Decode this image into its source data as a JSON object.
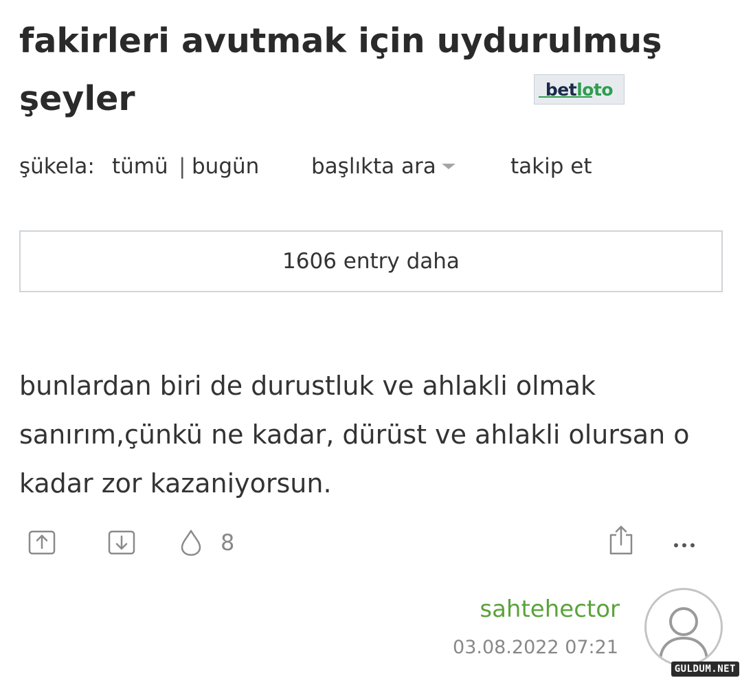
{
  "topic": {
    "title": "fakirleri avutmak için uydurulmuş şeyler"
  },
  "ad": {
    "brand_part1": "bet",
    "brand_part2": "loto"
  },
  "toolbar": {
    "sukela_label": "şükela:",
    "all_label": "tümü",
    "separator": "|",
    "today_label": "bugün",
    "search_label": "başlıkta ara",
    "follow_label": "takip et"
  },
  "more_entries": {
    "label": "1606 entry daha"
  },
  "entry": {
    "text": "bunlardan biri de durustluk ve ahlakli olmak sanırım,çünkü ne kadar, dürüst ve ahlakli olursan o kadar zor kazaniyorsun.",
    "favorite_count": "8",
    "author": "sahtehector",
    "timestamp": "03.08.2022 07:21"
  },
  "icons": {
    "upvote": "arrow-up-box-icon",
    "downvote": "arrow-down-box-icon",
    "favorite": "drop-icon",
    "share": "share-icon",
    "more": "ellipsis-icon",
    "avatar": "user-avatar-icon"
  },
  "colors": {
    "author": "#5aa33b",
    "text": "#333333",
    "muted": "#888888",
    "border": "#cfd3d8"
  },
  "watermark": {
    "text": "GULDUM.NET"
  }
}
